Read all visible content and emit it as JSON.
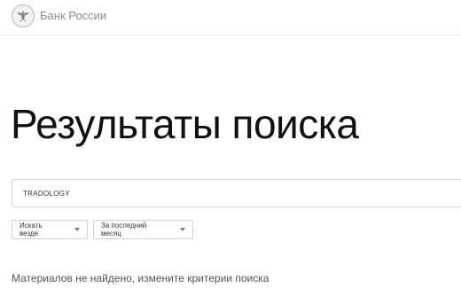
{
  "header": {
    "brand_name": "Банк России",
    "logo_icon": "double-headed-eagle-emblem-icon"
  },
  "main": {
    "title": "Результаты поиска",
    "search": {
      "value": "TRADOLOGY"
    },
    "filters": {
      "scope_label": "Искать везде",
      "period_label": "За последний месяц"
    },
    "empty_message": "Материалов не найдено, измените критерии поиска"
  }
}
